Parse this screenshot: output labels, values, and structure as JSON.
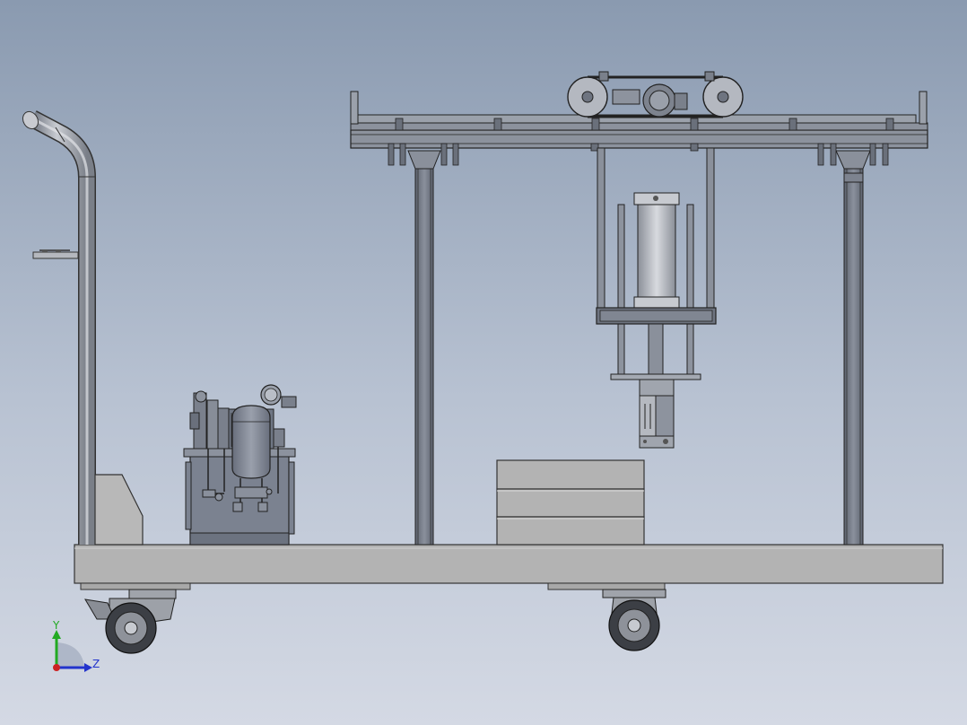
{
  "viewport": {
    "background_top": "#8a9ab0",
    "background_bottom": "#d4d9e4"
  },
  "model": {
    "components": [
      {
        "name": "push-handle"
      },
      {
        "name": "handle-bracket"
      },
      {
        "name": "hydraulic-power-unit"
      },
      {
        "name": "cart-deck"
      },
      {
        "name": "swivel-caster-with-brake"
      },
      {
        "name": "fixed-caster"
      },
      {
        "name": "gantry-frame"
      },
      {
        "name": "belt-drive"
      },
      {
        "name": "hydraulic-cylinder"
      },
      {
        "name": "gripper-head"
      },
      {
        "name": "stacked-blocks",
        "count": 3
      }
    ]
  },
  "triad": {
    "y_label": "Y",
    "z_label": "Z",
    "y_color": "#22aa22",
    "z_color": "#2233cc",
    "x_color": "#cc2222"
  }
}
